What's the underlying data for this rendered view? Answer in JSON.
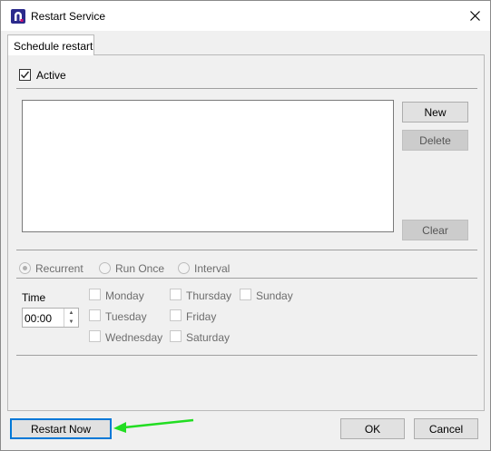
{
  "window": {
    "title": "Restart Service"
  },
  "tabs": [
    {
      "label": "Schedule restart"
    }
  ],
  "active_checkbox": {
    "label": "Active",
    "checked": true
  },
  "schedule_list": {
    "items": []
  },
  "side_buttons": {
    "new": "New",
    "delete": "Delete",
    "clear": "Clear"
  },
  "mode": {
    "options": [
      "Recurrent",
      "Run Once",
      "Interval"
    ],
    "selected": "Recurrent"
  },
  "time": {
    "label": "Time",
    "value": "00:00"
  },
  "days": [
    "Monday",
    "Tuesday",
    "Wednesday",
    "Thursday",
    "Friday",
    "Saturday",
    "Sunday"
  ],
  "footer": {
    "restart_now": "Restart Now",
    "ok": "OK",
    "cancel": "Cancel"
  },
  "colors": {
    "focus_border": "#0078d7",
    "arrow": "#22dd22",
    "app_icon": "#2b2a8c"
  },
  "icons": {
    "app": "app-logo-icon",
    "close": "close-icon",
    "check": "check-icon",
    "spin_up": "spin-up-icon",
    "spin_down": "spin-down-icon"
  }
}
